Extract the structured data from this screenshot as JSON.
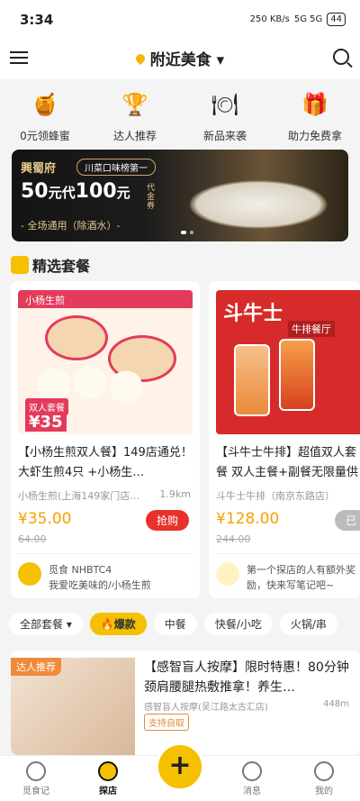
{
  "status": {
    "time": "3:34",
    "speed": "250 KB/s",
    "net": "5G 5G",
    "battery": "44"
  },
  "header": {
    "location": "附近美食 ▾"
  },
  "categories": [
    {
      "label": "0元领蜂蜜",
      "icon": "honey-jar-icon",
      "glyph": "🍯"
    },
    {
      "label": "达人推荐",
      "icon": "trophy-icon",
      "glyph": "🏆"
    },
    {
      "label": "新品来袭",
      "icon": "cloche-icon",
      "glyph": "🍽"
    },
    {
      "label": "助力免费拿",
      "icon": "gift-icon",
      "glyph": "🎁"
    }
  ],
  "banner": {
    "brand": "興蜀府",
    "tag": "川菜口味榜第一",
    "main_a": "50",
    "main_unit": "元代",
    "main_b": "100",
    "main_unit2": "元",
    "side": "代金券",
    "note": "- 全场通用（除酒水）-"
  },
  "section": {
    "title": "精选套餐"
  },
  "deals": [
    {
      "title": "【小杨生煎双人餐】149店通兑！大虾生煎4只 +小杨生…",
      "shop": "小杨生煎(上海149家门店…",
      "distance": "1.9km",
      "price": "¥35.00",
      "original_price": "64.00",
      "buy_label": "抢购",
      "img_brand": "小杨生煎",
      "img_tag": "双人套餐",
      "img_price": "¥35",
      "tip_user": "觅食 NHBTC4",
      "tip_text": "我爱吃美味的/小杨生煎"
    },
    {
      "title": "【斗牛士牛排】超值双人套餐 双人主餐+副餐无限量供应",
      "shop": "斗牛士牛排（南京东路店）",
      "price": "¥128.00",
      "original_price": "244.00",
      "buy_label": "已",
      "img_brand": "斗牛士",
      "img_sub": "牛排餐厅",
      "tip_text": "第一个探店的人有额外奖励，快来写笔记吧~"
    }
  ],
  "filters": [
    "全部套餐 ▾",
    "🔥爆款",
    "中餐",
    "快餐/小吃",
    "火锅/串"
  ],
  "feed": {
    "badge": "达人推荐",
    "title": "【感智盲人按摩】限时特惠！80分钟颈肩腰腿热敷推拿！养生…",
    "shop": "感智盲人按摩(吴江路太古汇店)",
    "distance": "448m",
    "tag": "支持自取"
  },
  "tabs": [
    {
      "label": "觅食记"
    },
    {
      "label": "探店"
    },
    {
      "label": "消息"
    },
    {
      "label": "我的"
    }
  ],
  "fab": "+",
  "colors": {
    "accent": "#f5c000",
    "price": "#f5a000",
    "buy": "#e8312a"
  }
}
